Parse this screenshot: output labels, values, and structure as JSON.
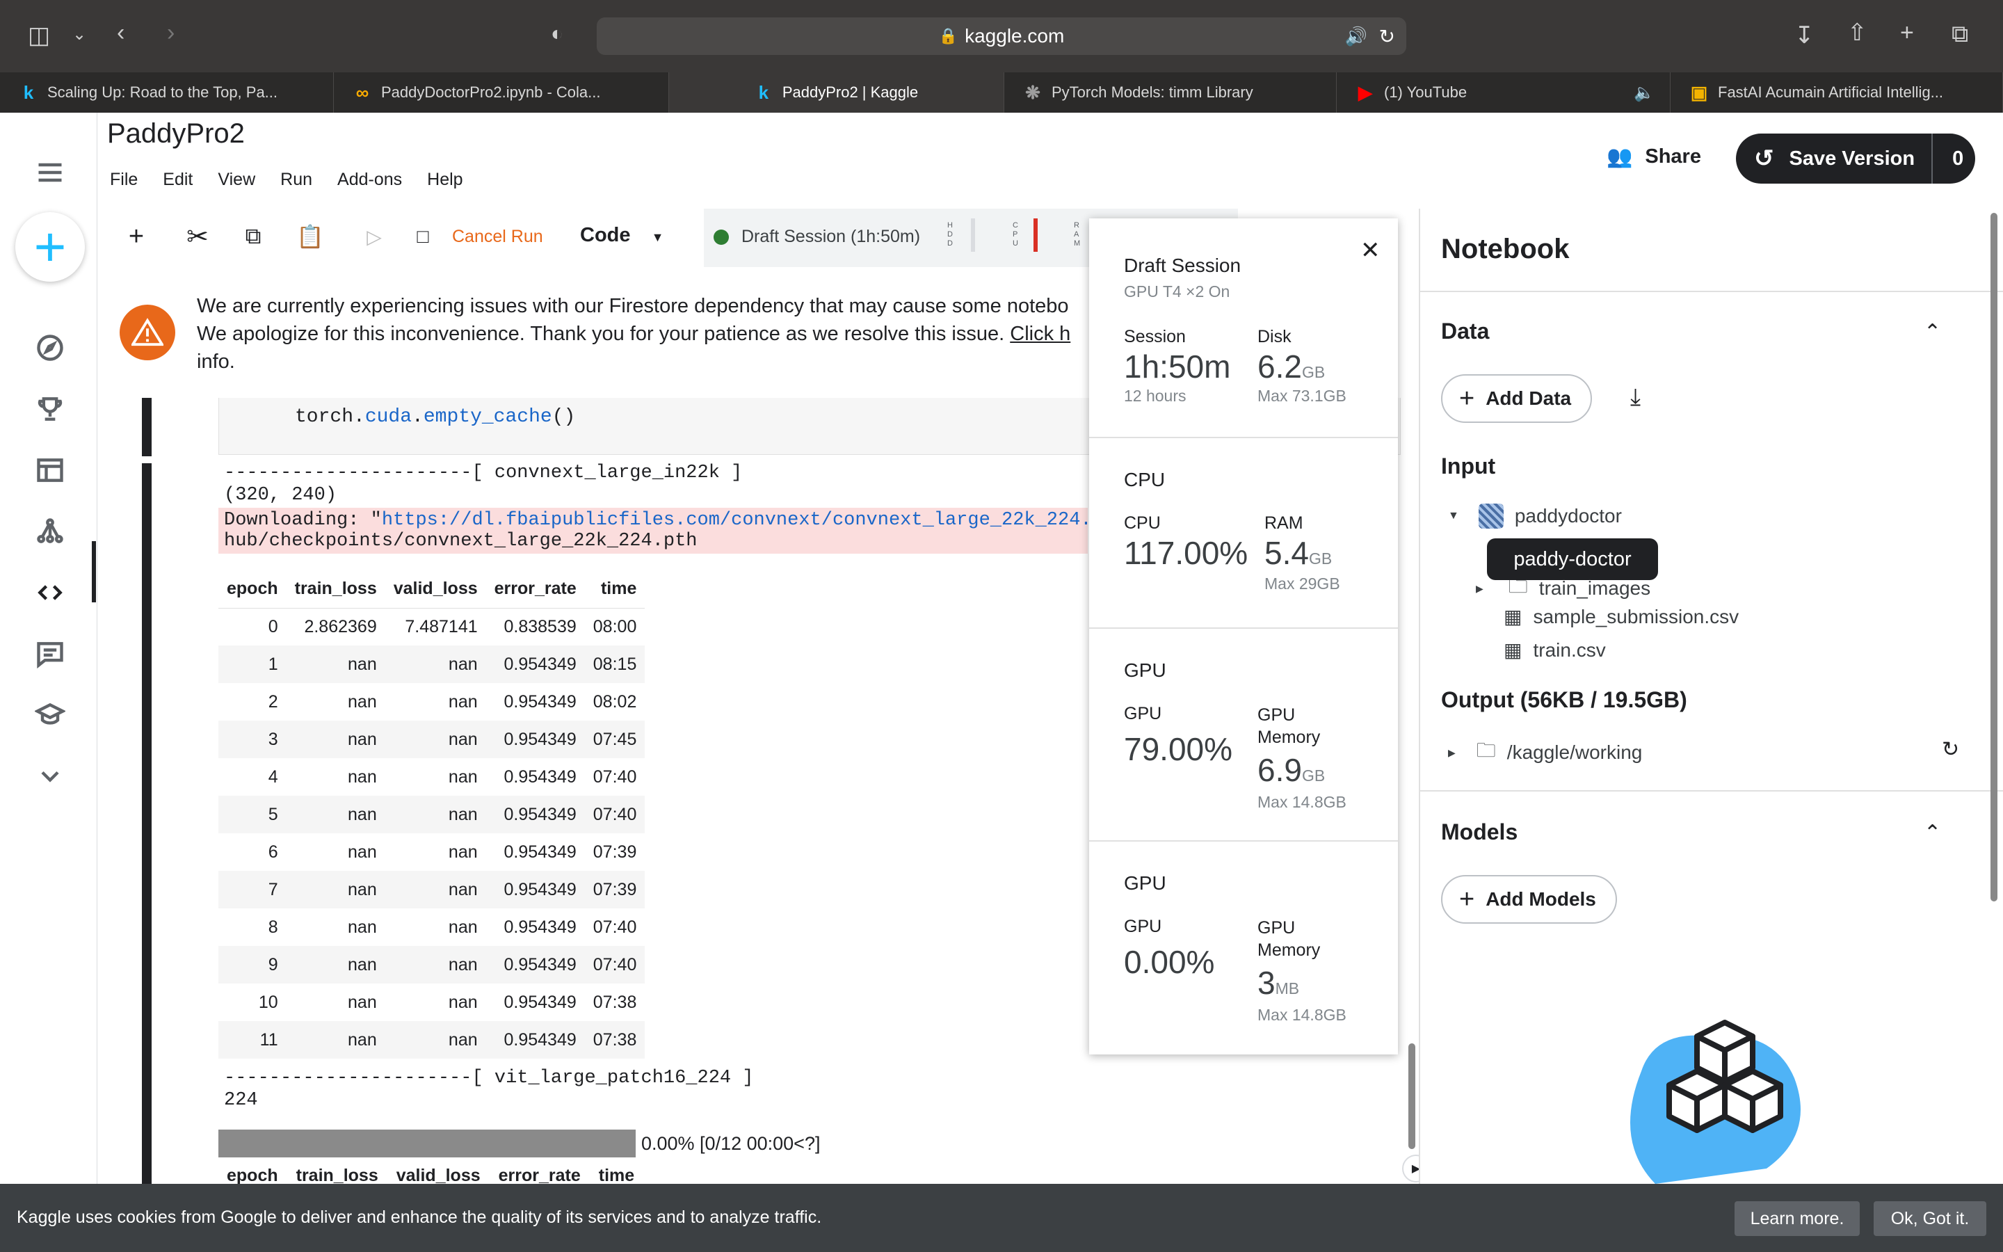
{
  "browser": {
    "url": "kaggle.com",
    "tabs": [
      {
        "label": "Scaling Up: Road to the Top, Pa...",
        "icon": "kaggle-icon"
      },
      {
        "label": "PaddyDoctorPro2.ipynb - Cola...",
        "icon": "colab-icon"
      },
      {
        "label": "PaddyPro2 | Kaggle",
        "icon": "kaggle-icon"
      },
      {
        "label": "PyTorch Models: timm Library",
        "icon": "openai-icon"
      },
      {
        "label": "(1) YouTube",
        "icon": "youtube-icon"
      },
      {
        "label": "FastAI Acumain Artificial Intellig...",
        "icon": "slides-icon"
      }
    ]
  },
  "notebook": {
    "title": "PaddyPro2",
    "menu": [
      "File",
      "Edit",
      "View",
      "Run",
      "Add-ons",
      "Help"
    ],
    "share_label": "Share",
    "save_label": "Save Version",
    "save_count": "0",
    "cancel_run": "Cancel Run",
    "cell_type": "Code",
    "draft_session": "Draft Session (1h:50m)",
    "meters": [
      "H D D",
      "C P U",
      "R A M"
    ]
  },
  "alert": {
    "line1": "We are currently experiencing issues with our Firestore dependency that may cause some notebo",
    "line2": "We apologize for this inconvenience. Thank you for your patience as we resolve this issue.",
    "link": "Click h",
    "line3": "info."
  },
  "code": {
    "prefix": "torch.",
    "mod": "cuda",
    "dot": ".",
    "fn": "empty_cache",
    "suffix": "()"
  },
  "output1": {
    "header": "----------------------[ convnext_large_in22k ]",
    "size": "(320, 240)",
    "download_prefix": "Downloading: \"",
    "download_url": "https://dl.fbaipublicfiles.com/convnext/convnext_large_22k_224.pth",
    "download_line2": "hub/checkpoints/convnext_large_22k_224.pth"
  },
  "results_table": {
    "columns": [
      "epoch",
      "train_loss",
      "valid_loss",
      "error_rate",
      "time"
    ],
    "rows": [
      [
        "0",
        "2.862369",
        "7.487141",
        "0.838539",
        "08:00"
      ],
      [
        "1",
        "nan",
        "nan",
        "0.954349",
        "08:15"
      ],
      [
        "2",
        "nan",
        "nan",
        "0.954349",
        "08:02"
      ],
      [
        "3",
        "nan",
        "nan",
        "0.954349",
        "07:45"
      ],
      [
        "4",
        "nan",
        "nan",
        "0.954349",
        "07:40"
      ],
      [
        "5",
        "nan",
        "nan",
        "0.954349",
        "07:40"
      ],
      [
        "6",
        "nan",
        "nan",
        "0.954349",
        "07:39"
      ],
      [
        "7",
        "nan",
        "nan",
        "0.954349",
        "07:39"
      ],
      [
        "8",
        "nan",
        "nan",
        "0.954349",
        "07:40"
      ],
      [
        "9",
        "nan",
        "nan",
        "0.954349",
        "07:40"
      ],
      [
        "10",
        "nan",
        "nan",
        "0.954349",
        "07:38"
      ],
      [
        "11",
        "nan",
        "nan",
        "0.954349",
        "07:38"
      ]
    ]
  },
  "output2": {
    "header": "----------------------[ vit_large_patch16_224 ]",
    "size": "224",
    "progress_text": "0.00% [0/12 00:00<?]",
    "progress_fraction": 1.0,
    "table2_columns": [
      "epoch",
      "train_loss",
      "valid_loss",
      "error_rate",
      "time"
    ]
  },
  "session_popup": {
    "title": "Draft Session",
    "subtitle": "GPU T4 ×2 On",
    "session_label": "Session",
    "session_value": "1h:50m",
    "session_sub": "12 hours",
    "disk_label": "Disk",
    "disk_value": "6.2",
    "disk_unit": "GB",
    "disk_sub": "Max 73.1GB",
    "cpu_section": "CPU",
    "cpu_label": "CPU",
    "cpu_value": "117.00%",
    "ram_label": "RAM",
    "ram_value": "5.4",
    "ram_unit": "GB",
    "ram_sub": "Max 29GB",
    "gpu1_section": "GPU",
    "gpu1_label": "GPU",
    "gpu1_value": "79.00%",
    "gpu1_mem_label1": "GPU",
    "gpu1_mem_label2": "Memory",
    "gpu1_mem_value": "6.9",
    "gpu1_mem_unit": "GB",
    "gpu1_mem_sub": "Max 14.8GB",
    "gpu2_section": "GPU",
    "gpu2_label": "GPU",
    "gpu2_value": "0.00%",
    "gpu2_mem_label1": "GPU",
    "gpu2_mem_label2": "Memory",
    "gpu2_mem_value": "3",
    "gpu2_mem_unit": "MB",
    "gpu2_mem_sub": "Max 14.8GB"
  },
  "sidebar": {
    "title": "Notebook",
    "data_header": "Data",
    "add_data": "Add Data",
    "input_header": "Input",
    "dataset": "paddydoctor",
    "tooltip": "paddy-doctor",
    "files": [
      "train_images",
      "sample_submission.csv",
      "train.csv"
    ],
    "output_header": "Output (56KB / 19.5GB)",
    "output_path": "/kaggle/working",
    "models_header": "Models",
    "add_models": "Add Models"
  },
  "cookie": {
    "text": "Kaggle uses cookies from Google to deliver and enhance the quality of its services and to analyze traffic.",
    "learn_more": "Learn more.",
    "ok": "Ok, Got it."
  }
}
